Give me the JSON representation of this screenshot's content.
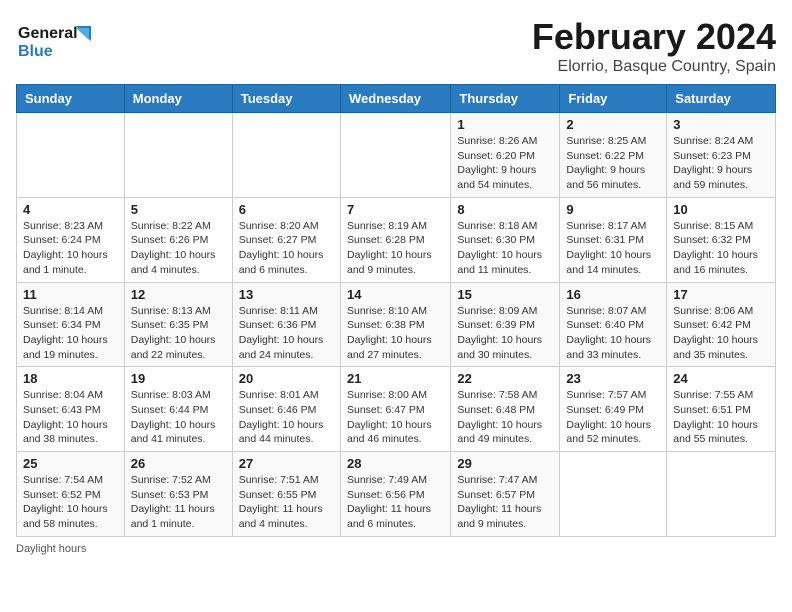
{
  "app": {
    "logo_line1": "General",
    "logo_line2": "Blue"
  },
  "header": {
    "title": "February 2024",
    "subtitle": "Elorrio, Basque Country, Spain"
  },
  "days_of_week": [
    "Sunday",
    "Monday",
    "Tuesday",
    "Wednesday",
    "Thursday",
    "Friday",
    "Saturday"
  ],
  "weeks": [
    [
      {
        "day": "",
        "info": ""
      },
      {
        "day": "",
        "info": ""
      },
      {
        "day": "",
        "info": ""
      },
      {
        "day": "",
        "info": ""
      },
      {
        "day": "1",
        "info": "Sunrise: 8:26 AM\nSunset: 6:20 PM\nDaylight: 9 hours and 54 minutes."
      },
      {
        "day": "2",
        "info": "Sunrise: 8:25 AM\nSunset: 6:22 PM\nDaylight: 9 hours and 56 minutes."
      },
      {
        "day": "3",
        "info": "Sunrise: 8:24 AM\nSunset: 6:23 PM\nDaylight: 9 hours and 59 minutes."
      }
    ],
    [
      {
        "day": "4",
        "info": "Sunrise: 8:23 AM\nSunset: 6:24 PM\nDaylight: 10 hours and 1 minute."
      },
      {
        "day": "5",
        "info": "Sunrise: 8:22 AM\nSunset: 6:26 PM\nDaylight: 10 hours and 4 minutes."
      },
      {
        "day": "6",
        "info": "Sunrise: 8:20 AM\nSunset: 6:27 PM\nDaylight: 10 hours and 6 minutes."
      },
      {
        "day": "7",
        "info": "Sunrise: 8:19 AM\nSunset: 6:28 PM\nDaylight: 10 hours and 9 minutes."
      },
      {
        "day": "8",
        "info": "Sunrise: 8:18 AM\nSunset: 6:30 PM\nDaylight: 10 hours and 11 minutes."
      },
      {
        "day": "9",
        "info": "Sunrise: 8:17 AM\nSunset: 6:31 PM\nDaylight: 10 hours and 14 minutes."
      },
      {
        "day": "10",
        "info": "Sunrise: 8:15 AM\nSunset: 6:32 PM\nDaylight: 10 hours and 16 minutes."
      }
    ],
    [
      {
        "day": "11",
        "info": "Sunrise: 8:14 AM\nSunset: 6:34 PM\nDaylight: 10 hours and 19 minutes."
      },
      {
        "day": "12",
        "info": "Sunrise: 8:13 AM\nSunset: 6:35 PM\nDaylight: 10 hours and 22 minutes."
      },
      {
        "day": "13",
        "info": "Sunrise: 8:11 AM\nSunset: 6:36 PM\nDaylight: 10 hours and 24 minutes."
      },
      {
        "day": "14",
        "info": "Sunrise: 8:10 AM\nSunset: 6:38 PM\nDaylight: 10 hours and 27 minutes."
      },
      {
        "day": "15",
        "info": "Sunrise: 8:09 AM\nSunset: 6:39 PM\nDaylight: 10 hours and 30 minutes."
      },
      {
        "day": "16",
        "info": "Sunrise: 8:07 AM\nSunset: 6:40 PM\nDaylight: 10 hours and 33 minutes."
      },
      {
        "day": "17",
        "info": "Sunrise: 8:06 AM\nSunset: 6:42 PM\nDaylight: 10 hours and 35 minutes."
      }
    ],
    [
      {
        "day": "18",
        "info": "Sunrise: 8:04 AM\nSunset: 6:43 PM\nDaylight: 10 hours and 38 minutes."
      },
      {
        "day": "19",
        "info": "Sunrise: 8:03 AM\nSunset: 6:44 PM\nDaylight: 10 hours and 41 minutes."
      },
      {
        "day": "20",
        "info": "Sunrise: 8:01 AM\nSunset: 6:46 PM\nDaylight: 10 hours and 44 minutes."
      },
      {
        "day": "21",
        "info": "Sunrise: 8:00 AM\nSunset: 6:47 PM\nDaylight: 10 hours and 46 minutes."
      },
      {
        "day": "22",
        "info": "Sunrise: 7:58 AM\nSunset: 6:48 PM\nDaylight: 10 hours and 49 minutes."
      },
      {
        "day": "23",
        "info": "Sunrise: 7:57 AM\nSunset: 6:49 PM\nDaylight: 10 hours and 52 minutes."
      },
      {
        "day": "24",
        "info": "Sunrise: 7:55 AM\nSunset: 6:51 PM\nDaylight: 10 hours and 55 minutes."
      }
    ],
    [
      {
        "day": "25",
        "info": "Sunrise: 7:54 AM\nSunset: 6:52 PM\nDaylight: 10 hours and 58 minutes."
      },
      {
        "day": "26",
        "info": "Sunrise: 7:52 AM\nSunset: 6:53 PM\nDaylight: 11 hours and 1 minute."
      },
      {
        "day": "27",
        "info": "Sunrise: 7:51 AM\nSunset: 6:55 PM\nDaylight: 11 hours and 4 minutes."
      },
      {
        "day": "28",
        "info": "Sunrise: 7:49 AM\nSunset: 6:56 PM\nDaylight: 11 hours and 6 minutes."
      },
      {
        "day": "29",
        "info": "Sunrise: 7:47 AM\nSunset: 6:57 PM\nDaylight: 11 hours and 9 minutes."
      },
      {
        "day": "",
        "info": ""
      },
      {
        "day": "",
        "info": ""
      }
    ]
  ],
  "footer": {
    "note": "Daylight hours"
  }
}
